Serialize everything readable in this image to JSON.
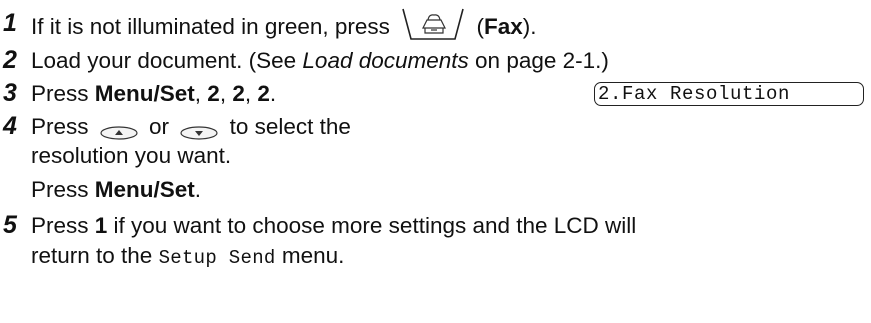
{
  "steps": [
    {
      "number": "1",
      "before": "If it is not illuminated in green, press",
      "key_label": "Fax",
      "after_open": "(",
      "after_close": ")."
    },
    {
      "number": "2",
      "before": "Load your document. (See ",
      "italic": "Load documents",
      "after": " on page 2-1.)"
    },
    {
      "number": "3",
      "before": "Press ",
      "bold": "Menu/Set",
      "rest": [
        ", ",
        "2",
        ", ",
        "2",
        ", ",
        "2",
        "."
      ]
    },
    {
      "number": "4",
      "before": "Press",
      "or": "or",
      "after": "to select the",
      "line2": "resolution you want.",
      "line3_before": "Press ",
      "line3_bold": "Menu/Set",
      "line3_after": "."
    },
    {
      "number": "5",
      "before": "Press ",
      "bold": "1",
      "after": " if you want to choose more settings and the LCD will",
      "line2_before": "return to the ",
      "line2_mono": "Setup Send",
      "line2_after": " menu."
    }
  ],
  "lcd": {
    "text": "2.Fax Resolution"
  },
  "icons": {
    "fax_key": "fax-machine-icon",
    "up_key": "up-arrow-key-icon",
    "down_key": "down-arrow-key-icon"
  }
}
